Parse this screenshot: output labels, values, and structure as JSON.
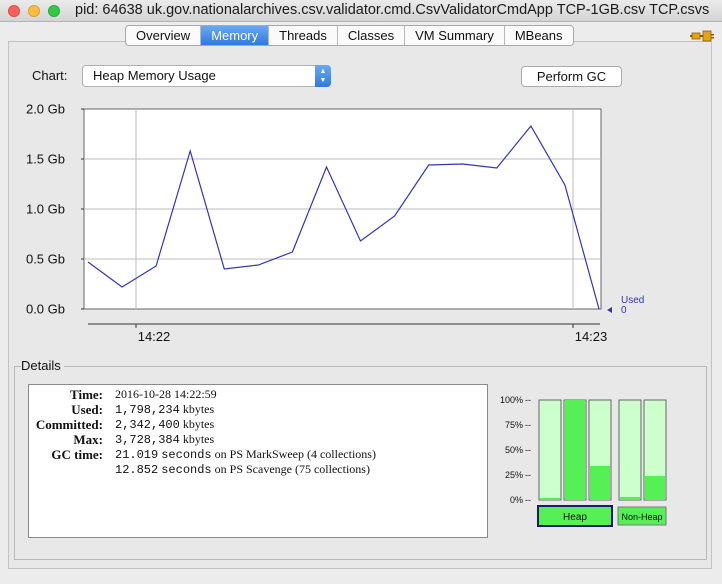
{
  "window": {
    "title": "pid: 64638 uk.gov.nationalarchives.csv.validator.cmd.CsvValidatorCmdApp TCP-1GB.csv TCP.csvs"
  },
  "tabs": [
    {
      "label": "Overview"
    },
    {
      "label": "Memory",
      "active": true
    },
    {
      "label": "Threads"
    },
    {
      "label": "Classes"
    },
    {
      "label": "VM Summary"
    },
    {
      "label": "MBeans"
    }
  ],
  "toolbar": {
    "chart_label": "Chart:",
    "chart_selected": "Heap Memory Usage",
    "perform_gc_label": "Perform GC"
  },
  "chart_data": {
    "type": "line",
    "y_ticks": [
      "2.0 Gb",
      "1.5 Gb",
      "1.0 Gb",
      "0.5 Gb",
      "0.0 Gb"
    ],
    "ylim": [
      0,
      2.0
    ],
    "x_ticks": [
      "14:22",
      "14:23"
    ],
    "series": [
      {
        "name": "Used",
        "color": "#3333bb",
        "values": [
          0.47,
          0.22,
          0.43,
          1.58,
          0.4,
          0.44,
          0.57,
          1.42,
          0.68,
          0.93,
          1.44,
          1.45,
          1.41,
          1.83,
          1.24,
          0.0
        ]
      }
    ],
    "legend": {
      "label": "Used",
      "value": "0"
    },
    "grid": true
  },
  "details": {
    "title": "Details",
    "rows": [
      {
        "label": "Time:",
        "value": "2016-10-28 14:22:59"
      },
      {
        "label": "Used:",
        "value": "1,798,234",
        "unit": "kbytes"
      },
      {
        "label": "Committed:",
        "value": "2,342,400",
        "unit": "kbytes"
      },
      {
        "label": "Max:",
        "value": "3,728,384",
        "unit": "kbytes"
      },
      {
        "label": "GC time:",
        "value": "21.019",
        "unit": "seconds",
        "suffix": "on PS MarkSweep (4 collections)"
      },
      {
        "label": "",
        "value": "12.852",
        "unit": "seconds",
        "suffix": "on PS Scavenge (75 collections)"
      }
    ]
  },
  "pools": {
    "scale": [
      "100%",
      "75%",
      "50%",
      "25%",
      "0%"
    ],
    "heap_fill": [
      0.02,
      1.0,
      0.34
    ],
    "nonheap_fill": [
      0.03,
      0.24
    ],
    "heap_label": "Heap",
    "nonheap_label": "Non-Heap"
  },
  "colors": {
    "accent": "#2f79df",
    "bar_fill": "#55f055",
    "bar_bg": "#ccffcc",
    "line": "#3333bb"
  }
}
